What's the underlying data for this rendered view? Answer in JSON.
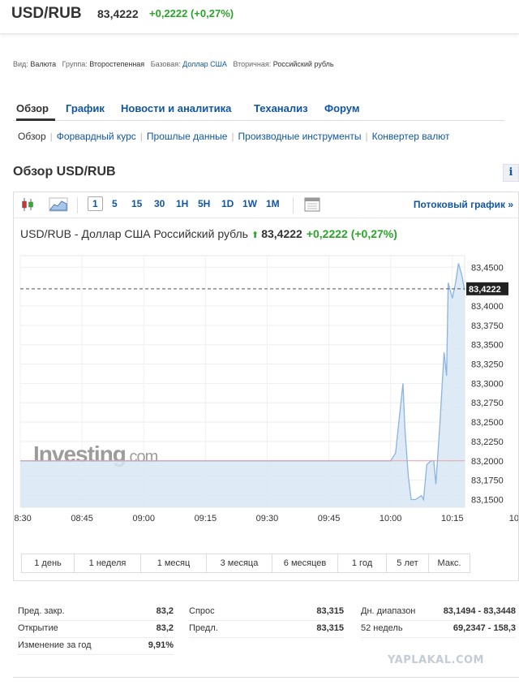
{
  "header": {
    "pair": "USD/RUB",
    "price": "83,4222",
    "change": "+0,2222 (+0,27%)"
  },
  "meta": {
    "type_label": "Вид:",
    "type_value": "Валюта",
    "group_label": "Группа:",
    "group_value": "Второстепенная",
    "base_label": "Базовая:",
    "base_value": "Доллар США",
    "secondary_label": "Вторичная:",
    "secondary_value": "Российский рубль"
  },
  "tabs": [
    "Обзор",
    "График",
    "Новости и аналитика",
    "Теханализ",
    "Форум"
  ],
  "subnav": [
    "Обзор",
    "Форвардный курс",
    "Прошлые данные",
    "Производные инструменты",
    "Конвертер валют"
  ],
  "section_title": "Обзор USD/RUB",
  "info_glyph": "i",
  "toolbar": {
    "timeframes": [
      "1",
      "5",
      "15",
      "30",
      "1H",
      "5H",
      "1D",
      "1W",
      "1M"
    ],
    "active_timeframe": "1",
    "stream_link": "Потоковый график »"
  },
  "chart_header": {
    "title": "USD/RUB - Доллар США Российский рубль",
    "arrow": "⬆",
    "price": "83,4222",
    "change": "+0,2222 (+0,27%)"
  },
  "chart_data": {
    "type": "area",
    "x_ticks": [
      "08:30",
      "08:45",
      "09:00",
      "09:15",
      "09:30",
      "09:45",
      "10:00",
      "10:15",
      "10"
    ],
    "y_ticks": [
      "83,4500",
      "83,4000",
      "83,3750",
      "83,3500",
      "83,3250",
      "83,3000",
      "83,2750",
      "83,2500",
      "83,2250",
      "83,2000",
      "83,1750",
      "83,1500"
    ],
    "ylim": [
      83.14,
      83.465
    ],
    "x_minutes_range": [
      0,
      108
    ],
    "current_price_label": "83,4222",
    "current_price": 83.4222,
    "prev_close": 83.2,
    "series": [
      {
        "x": [
          0,
          25,
          50,
          75,
          90,
          91.2,
          93,
          93.5,
          94.3,
          95,
          96,
          97.5,
          98,
          98.8,
          99.8,
          100.5,
          101,
          102,
          103,
          103.6,
          104,
          105,
          105.8,
          106.5,
          107.3,
          108
        ],
        "y": [
          83.2,
          83.2,
          83.2,
          83.2,
          83.2,
          83.21,
          83.3,
          83.24,
          83.18,
          83.15,
          83.15,
          83.155,
          83.15,
          83.195,
          83.2,
          83.2,
          83.17,
          83.25,
          83.34,
          83.31,
          83.43,
          83.41,
          83.43,
          83.455,
          83.44,
          83.42
        ]
      }
    ],
    "watermark": "Investing.com"
  },
  "ranges": [
    "1 день",
    "1 неделя",
    "1 месяц",
    "3 месяца",
    "6 месяцев",
    "1 год",
    "5 лет",
    "Макс."
  ],
  "stats": {
    "col1": [
      {
        "label": "Пред. закр.",
        "value": "83,2"
      },
      {
        "label": "Открытие",
        "value": "83,2"
      },
      {
        "label": "Изменение за год",
        "value": "9,91%"
      }
    ],
    "col2": [
      {
        "label": "Спрос",
        "value": "83,315"
      },
      {
        "label": "Предл.",
        "value": "83,315"
      }
    ],
    "col3": [
      {
        "label": "Дн. диапазон",
        "value": "83,1494 - 83,3448"
      },
      {
        "label": "52 недель",
        "value": "69,2347 - 158,3"
      }
    ]
  },
  "watermark_site": "YAPLAKAL.COM",
  "colors": {
    "positive": "#2aa52a",
    "link": "#1256a0",
    "area_fill": "#d8e6f5",
    "line": "#8ab4e0"
  }
}
